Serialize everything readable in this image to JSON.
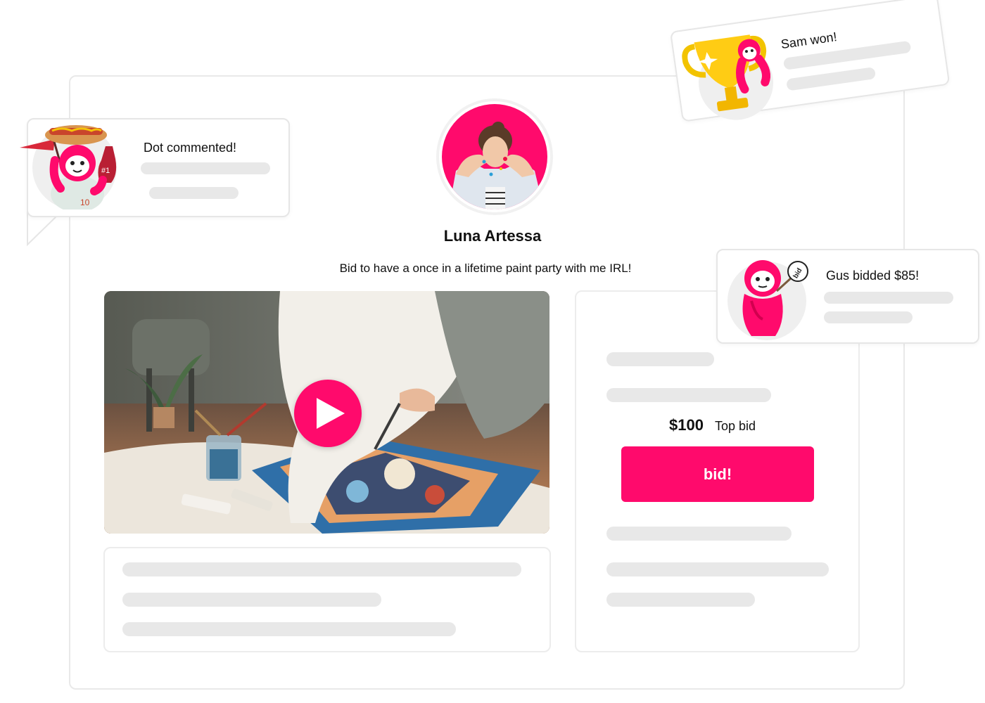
{
  "profile": {
    "name": "Luna Artessa",
    "tagline": "Bid to have a once in a lifetime paint party with me IRL!"
  },
  "auction": {
    "top_bid_amount": "$100",
    "top_bid_label": "Top bid",
    "bid_button_label": "bid!"
  },
  "notifications": {
    "comment": {
      "text": "Dot commented!",
      "sticker": "sloth-fan-icon"
    },
    "won": {
      "text": "Sam won!",
      "sticker": "sloth-trophy-icon"
    },
    "bid": {
      "text": "Gus bidded $85!",
      "sticker": "sloth-bid-icon"
    }
  },
  "video": {
    "play_icon": "play-icon"
  },
  "colors": {
    "accent": "#ff0a6c",
    "skeleton": "#e8e8e8",
    "border": "#e9e9e9"
  }
}
